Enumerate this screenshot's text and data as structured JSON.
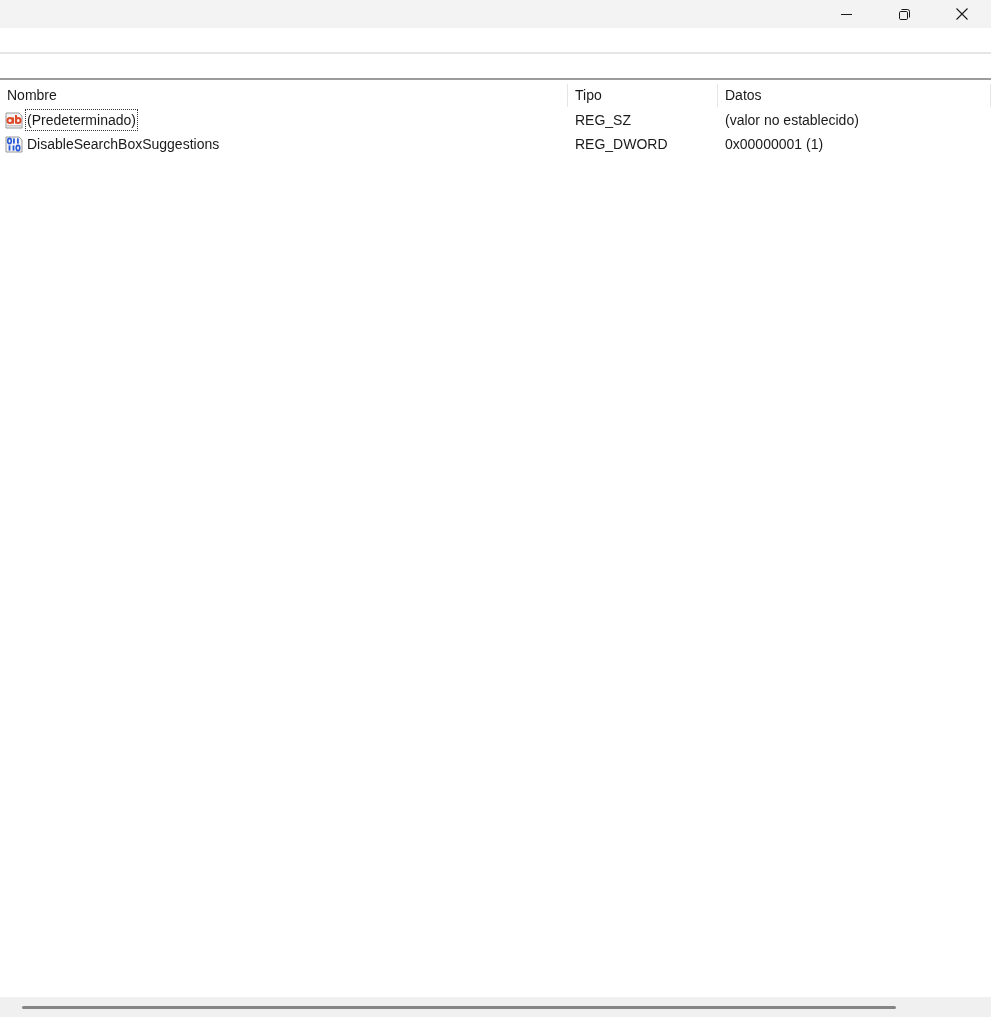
{
  "table": {
    "columns": [
      "Nombre",
      "Tipo",
      "Datos"
    ],
    "rows": [
      {
        "kind": "string",
        "name": "(Predeterminado)",
        "type": "REG_SZ",
        "data": "(valor no establecido)",
        "focused": true
      },
      {
        "kind": "binary",
        "name": "DisableSearchBoxSuggestions",
        "type": "REG_DWORD",
        "data": "0x00000001 (1)",
        "focused": false
      }
    ]
  }
}
